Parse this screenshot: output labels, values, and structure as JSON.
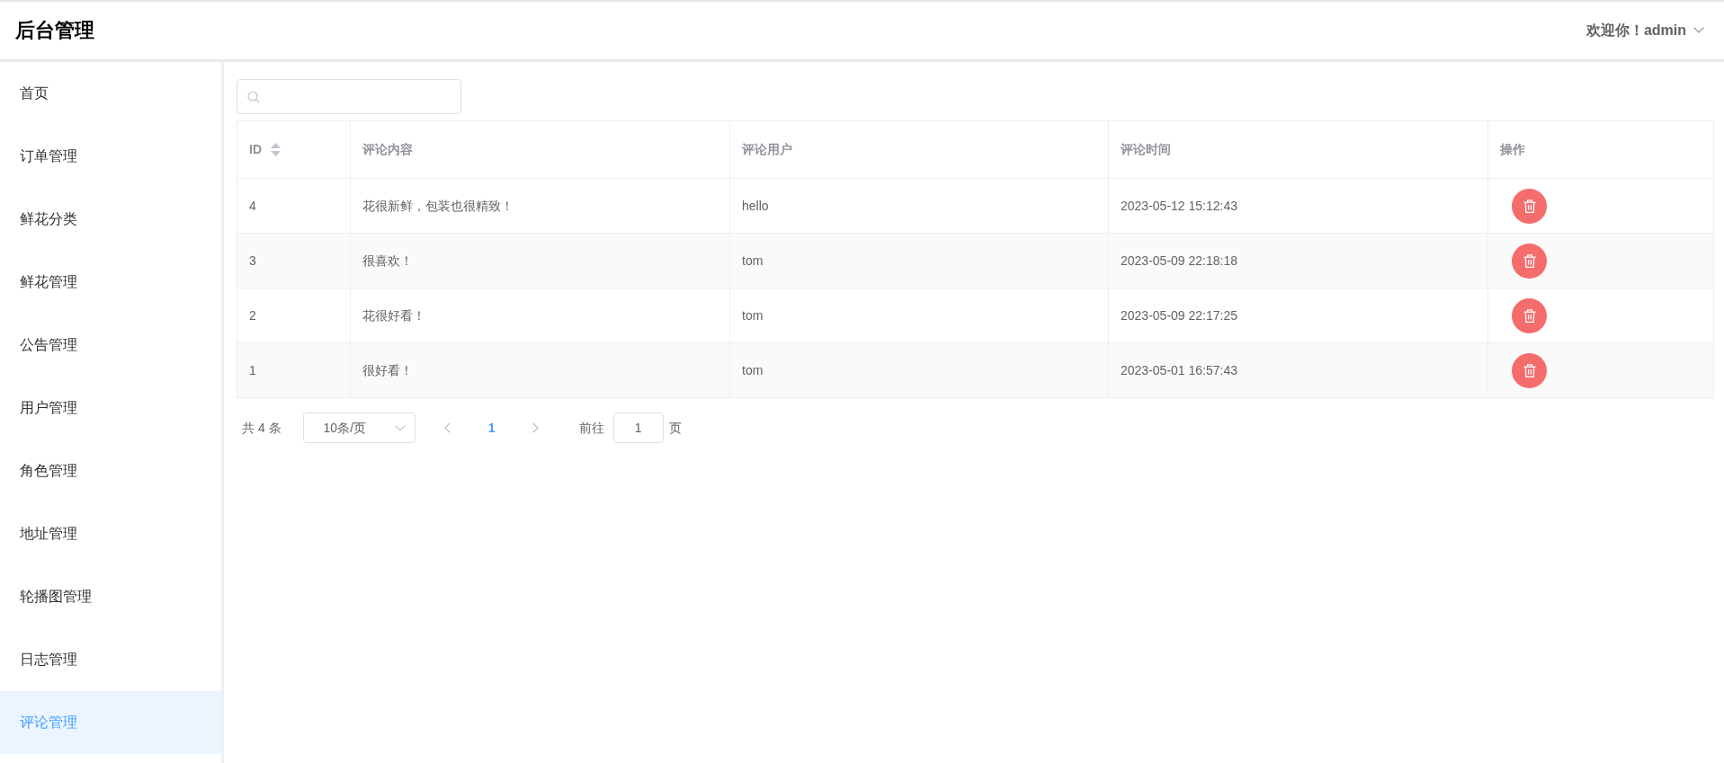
{
  "header": {
    "title": "后台管理",
    "user_menu": "欢迎你！admin"
  },
  "sidebar": {
    "items": [
      {
        "label": "首页",
        "selected": false
      },
      {
        "label": "订单管理",
        "selected": false
      },
      {
        "label": "鲜花分类",
        "selected": false
      },
      {
        "label": "鲜花管理",
        "selected": false
      },
      {
        "label": "公告管理",
        "selected": false
      },
      {
        "label": "用户管理",
        "selected": false
      },
      {
        "label": "角色管理",
        "selected": false
      },
      {
        "label": "地址管理",
        "selected": false
      },
      {
        "label": "轮播图管理",
        "selected": false
      },
      {
        "label": "日志管理",
        "selected": false
      },
      {
        "label": "评论管理",
        "selected": true
      }
    ]
  },
  "table": {
    "columns": [
      {
        "label": "ID",
        "kind": "text",
        "sortable": true
      },
      {
        "label": "评论内容",
        "kind": "text",
        "sortable": false
      },
      {
        "label": "评论用户",
        "kind": "text",
        "sortable": false
      },
      {
        "label": "评论时间",
        "kind": "text",
        "sortable": false
      },
      {
        "label": "操作",
        "kind": "actions",
        "sortable": false
      }
    ],
    "rows": [
      [
        "4",
        "花很新鲜，包装也很精致！",
        "hello",
        "2023-05-12 15:12:43"
      ],
      [
        "3",
        "很喜欢！",
        "tom",
        "2023-05-09 22:18:18"
      ],
      [
        "2",
        "花很好看！",
        "tom",
        "2023-05-09 22:17:25"
      ],
      [
        "1",
        "很好看！",
        "tom",
        "2023-05-01 16:57:43"
      ]
    ]
  },
  "pagination": {
    "total": "共 4 条",
    "page_size": "10条/页",
    "prev": {
      "disabled": true
    },
    "pages": [
      {
        "label": "1",
        "selected": true
      }
    ],
    "next": {
      "disabled": true
    },
    "goto_label": "前往",
    "goto_value": "1",
    "goto_suffix": "页"
  }
}
